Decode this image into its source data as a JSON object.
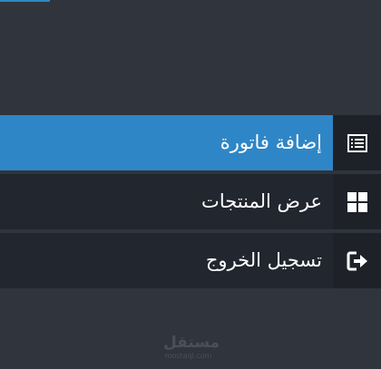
{
  "menu": {
    "items": [
      {
        "label": "إضافة فاتورة",
        "icon": "invoice-list-icon",
        "active": true
      },
      {
        "label": "عرض المنتجات",
        "icon": "grid-icon",
        "active": false
      },
      {
        "label": "تسجيل الخروج",
        "icon": "logout-icon",
        "active": false
      }
    ]
  },
  "watermark": {
    "main": "مستقل",
    "sub": "mostaql.com"
  },
  "colors": {
    "page_background": "#2f343d",
    "item_background": "#22262e",
    "icon_background": "#1e2228",
    "active_accent": "#2f86c6",
    "text": "#ffffff"
  }
}
